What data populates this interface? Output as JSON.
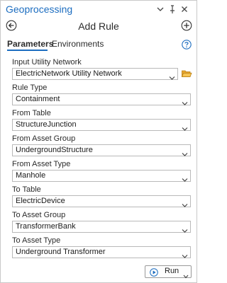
{
  "window": {
    "title": "Geoprocessing",
    "icons": [
      "chevron-down-icon",
      "pin-icon",
      "close-icon"
    ]
  },
  "header": {
    "tool_title": "Add Rule",
    "icons": [
      "back-arrow-icon",
      "add-icon"
    ]
  },
  "tabs": [
    {
      "label": "Parameters",
      "active": true
    },
    {
      "label": "Environments",
      "active": false
    }
  ],
  "help_icon": "help-icon",
  "parameters": [
    {
      "label": "Input Utility Network",
      "value": "ElectricNetwork Utility Network",
      "has_browse": true
    },
    {
      "label": "Rule Type",
      "value": "Containment"
    },
    {
      "label": "From Table",
      "value": "StructureJunction"
    },
    {
      "label": "From Asset Group",
      "value": "UndergroundStructure"
    },
    {
      "label": "From Asset Type",
      "value": "Manhole"
    },
    {
      "label": "To Table",
      "value": "ElectricDevice"
    },
    {
      "label": "To Asset Group",
      "value": "TransformerBank"
    },
    {
      "label": "To Asset Type",
      "value": "Underground Transformer"
    }
  ],
  "footer": {
    "run_label": "Run",
    "run_icon": "play-icon"
  },
  "colors": {
    "accent": "#1c6dc0",
    "folder": "#e8a830"
  }
}
